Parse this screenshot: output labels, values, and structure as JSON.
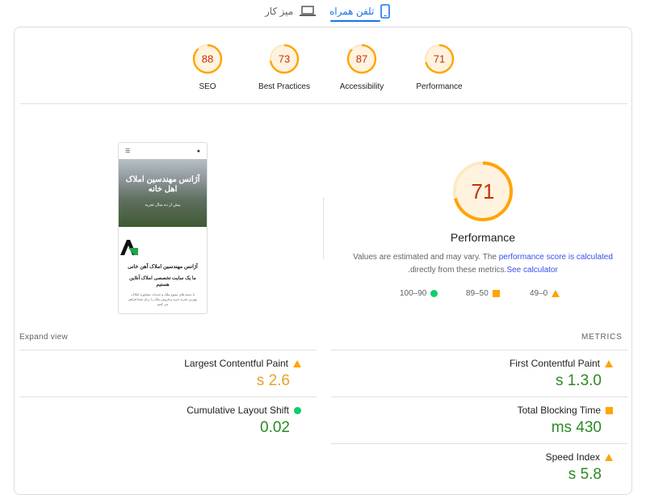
{
  "tabs": {
    "desktop_label": "میز کار",
    "mobile_label": "تلفن همراه"
  },
  "colors": {
    "accent": "#1a73e8",
    "average": "#ffa400",
    "good": "#0cce6b",
    "good_text": "#2b8a24",
    "average_text": "#e8a12b"
  },
  "summary_scores": [
    {
      "label": "SEO",
      "score": "88"
    },
    {
      "label": "Best Practices",
      "score": "73"
    },
    {
      "label": "Accessibility",
      "score": "87"
    },
    {
      "label": "Performance",
      "score": "71"
    }
  ],
  "preview": {
    "hero_title": "آژانس مهندسین املاک اهل خانه",
    "hero_sub": "بیش از ده سال تجربه",
    "site_title": "آژانس مهندسین املاک آهن خانی",
    "site_sub": "ما یک سایت تخصصی املاک آنلاین هستیم",
    "site_body": "با دسته های متنوع ملک و خدمات مشاوره املاک، بهترین تجربه خرید و فروش ملک را برای شما فراهم می کنیم"
  },
  "performance": {
    "score": "71",
    "title": "Performance",
    "desc_prefix": "Values are estimated and may vary. The",
    "desc_link": "performance score is calculated",
    "desc_mid": "directly from these metrics.",
    "desc_link2": "See calculator",
    "desc_end": "."
  },
  "legend": {
    "good": "100–90",
    "average": "89–50",
    "poor": "49–0"
  },
  "metrics_header": "METRICS",
  "expand_view": "Expand view",
  "metrics": {
    "lcp": {
      "name": "Largest Contentful Paint",
      "value": "s 2.6",
      "status": "average"
    },
    "cls": {
      "name": "Cumulative Layout Shift",
      "value": "0.02",
      "status": "good"
    },
    "fcp": {
      "name": "First Contentful Paint",
      "value": "s 1.3.0",
      "status": "average"
    },
    "tbt": {
      "name": "Total Blocking Time",
      "value": "ms 430",
      "status": "average"
    },
    "si": {
      "name": "Speed Index",
      "value": "s 5.8",
      "status": "average"
    }
  }
}
